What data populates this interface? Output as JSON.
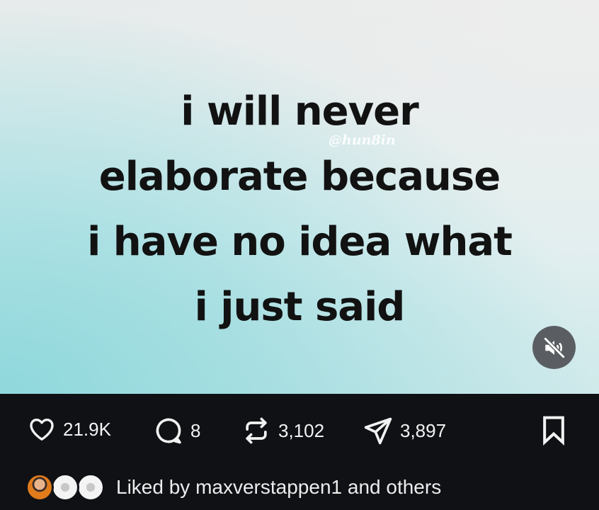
{
  "post": {
    "media": {
      "quote_lines": [
        "i will never",
        "elaborate because",
        "i have no idea what",
        "i just said"
      ],
      "watermark": "@hun8in",
      "mute_icon": "speaker-muted-icon"
    },
    "actions": {
      "likes": "21.9K",
      "comments": "8",
      "reposts": "3,102",
      "shares": "3,897",
      "icons": [
        "heart-icon",
        "comment-icon",
        "repost-icon",
        "share-icon",
        "bookmark-icon"
      ]
    },
    "liked_by": {
      "prefix": "Liked by ",
      "user": "maxverstappen1",
      "suffix": " and others"
    },
    "colors": {
      "background": "#0f1115",
      "text": "#ffffff",
      "mute_button": "#5a5e62"
    }
  }
}
